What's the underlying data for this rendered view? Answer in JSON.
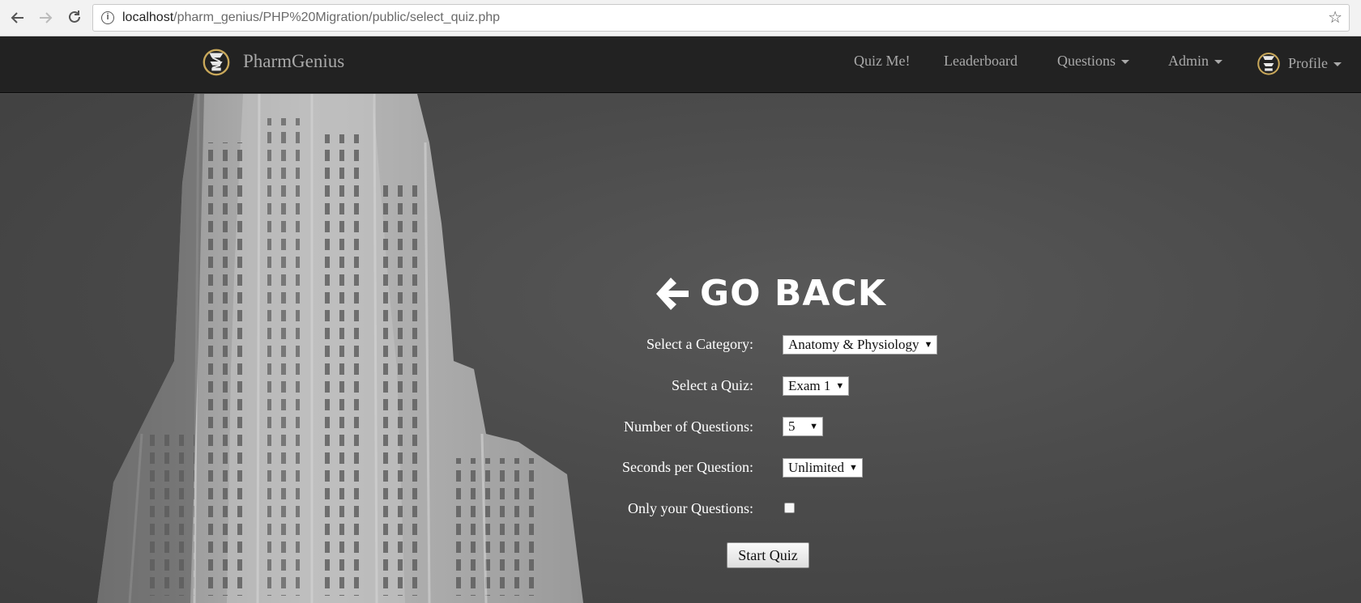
{
  "browser": {
    "url_host": "localhost",
    "url_path": "/pharm_genius/PHP%20Migration/public/select_quiz.php"
  },
  "navbar": {
    "brand": "PharmGenius",
    "items": [
      {
        "label": "Quiz Me!"
      },
      {
        "label": "Leaderboard"
      },
      {
        "label": "Questions"
      },
      {
        "label": "Admin"
      },
      {
        "label": "Profile"
      }
    ]
  },
  "form": {
    "go_back": "GO BACK",
    "category_label": "Select a Category:",
    "category_value": "Anatomy & Physiology",
    "quiz_label": "Select a Quiz:",
    "quiz_value": "Exam 1",
    "num_questions_label": "Number of Questions:",
    "num_questions_value": "5",
    "seconds_label": "Seconds per Question:",
    "seconds_value": "Unlimited",
    "only_yours_label": "Only your Questions:",
    "only_yours_checked": false,
    "start_button": "Start Quiz"
  },
  "colors": {
    "navbar_bg": "#222222",
    "nav_text": "#a9a9a9",
    "brand_gold": "#c9a85a",
    "hero_bg": "#4a4a4a"
  }
}
